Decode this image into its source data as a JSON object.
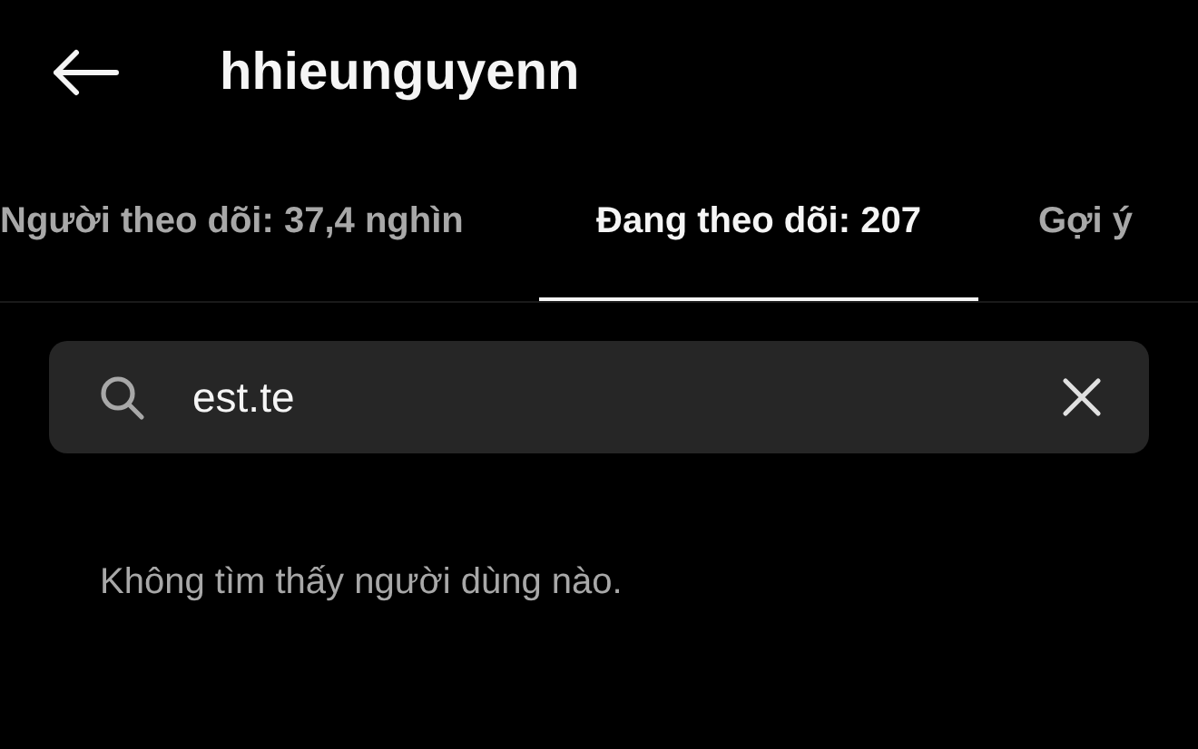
{
  "header": {
    "username": "hhieunguyenn"
  },
  "tabs": [
    {
      "label": "Người theo dõi: 37,4 nghìn",
      "selected": false
    },
    {
      "label": "Đang theo dõi: 207",
      "selected": true
    },
    {
      "label": "Gợi ý",
      "selected": false
    }
  ],
  "search": {
    "value": "est.te"
  },
  "message": "Không tìm thấy người dùng nào."
}
